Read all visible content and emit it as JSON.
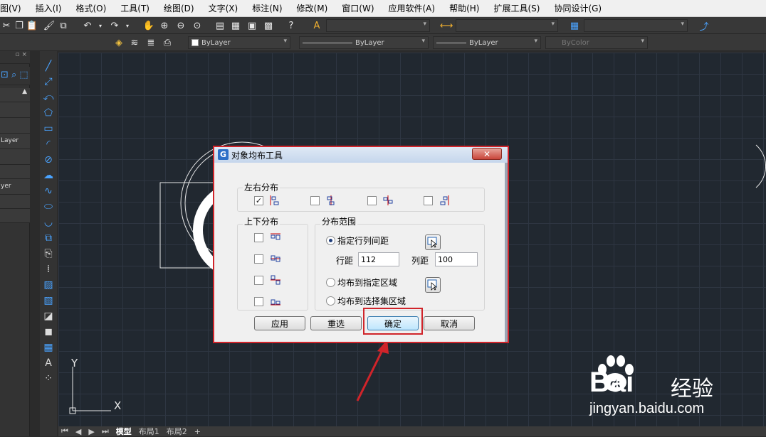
{
  "menu": [
    "图(V)",
    "插入(I)",
    "格式(O)",
    "工具(T)",
    "绘图(D)",
    "文字(X)",
    "标注(N)",
    "修改(M)",
    "窗口(W)",
    "应用软件(A)",
    "帮助(H)",
    "扩展工具(S)",
    "协同设计(G)"
  ],
  "toolbar2": {
    "color": "ByLayer",
    "linetype": "ByLayer",
    "lineweight": "ByLayer",
    "plotstyle": "ByColor"
  },
  "left_panel": {
    "row1": "Layer",
    "row2": "yer"
  },
  "tabs": [
    "模型",
    "布局1",
    "布局2",
    "+"
  ],
  "ucs": {
    "y": "Y",
    "x": "X"
  },
  "dialog": {
    "title": "对象均布工具",
    "close": "✕",
    "group_lr": "左右分布",
    "group_ud": "上下分布",
    "group_range": "分布范围",
    "radio_spacing": "指定行列间距",
    "row_label": "行距",
    "row_value": "112",
    "col_label": "列距",
    "col_value": "100",
    "radio_area": "均布到指定区域",
    "radio_selection": "均布到选择集区域",
    "btn_apply": "应用",
    "btn_reset": "重选",
    "btn_ok": "确定",
    "btn_cancel": "取消",
    "lr_checked": [
      true,
      false,
      false,
      false
    ],
    "ud_checked": [
      false,
      false,
      false,
      false
    ]
  },
  "watermark": {
    "brand": "Bai",
    "suffix": "经验",
    "url": "jingyan.baidu.com"
  },
  "colors": {
    "accent_red": "#d0242a",
    "canvas": "#212830",
    "tool_blue": "#4aa3ff"
  }
}
